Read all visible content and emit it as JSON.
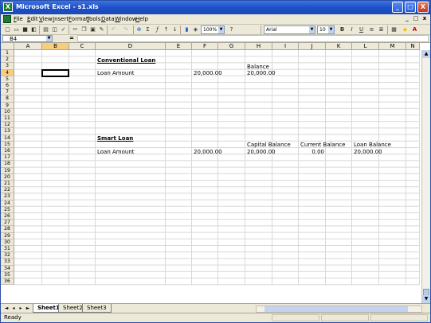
{
  "window": {
    "title": "Microsoft Excel - s1.xls",
    "app_icon": "excel-icon",
    "buttons": [
      "_",
      "□",
      "X"
    ]
  },
  "menu": {
    "items": [
      "File",
      "Edit",
      "View",
      "Insert",
      "Format",
      "Tools",
      "Data",
      "Window",
      "Help"
    ],
    "right_buttons": [
      "_",
      "□",
      "x"
    ]
  },
  "toolbar": {
    "zoom": "100%",
    "font": "Arial",
    "size": "10",
    "bold": "B",
    "italic": "I",
    "underline": "U"
  },
  "formula_bar": {
    "name_box": "B4",
    "fx": "=",
    "value": ""
  },
  "columns": [
    "A",
    "B",
    "C",
    "D",
    "E",
    "F",
    "G",
    "H",
    "I",
    "J",
    "K",
    "L",
    "M",
    "N"
  ],
  "rows": [
    "1",
    "2",
    "3",
    "4",
    "5",
    "6",
    "7",
    "8",
    "9",
    "10",
    "11",
    "12",
    "13",
    "14",
    "15",
    "16",
    "17",
    "18",
    "19",
    "20",
    "21",
    "22",
    "23",
    "24",
    "25",
    "26",
    "27",
    "28",
    "29",
    "30",
    "31",
    "32",
    "33",
    "34",
    "35",
    "36"
  ],
  "cells": {
    "D2": "Conventional Loan",
    "H3": "Balance",
    "D4": "Loan Amount",
    "F4": "20,000.00",
    "H4": "20,000.00",
    "D14": "Smart Loan",
    "H15": "Capital Balance",
    "J15": "Current Balance",
    "L15": "Loan Balance",
    "D16": "Loan Amount",
    "F16": "20,000.00",
    "H16": "20,000.00",
    "J16": "0.00",
    "L16": "20,000.00"
  },
  "sheets": [
    "Sheet1",
    "Sheet2",
    "Sheet3"
  ],
  "active_sheet": "Sheet1",
  "status": "Ready"
}
